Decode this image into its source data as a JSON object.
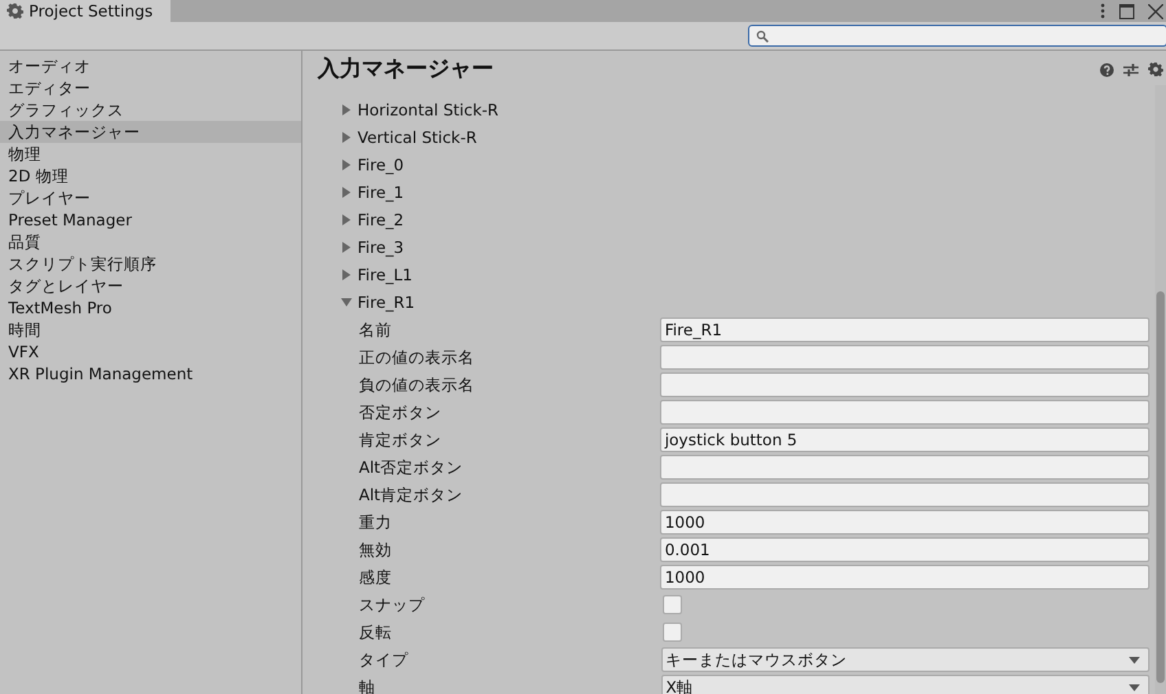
{
  "window": {
    "title": "Project Settings"
  },
  "sidebar": {
    "items": [
      {
        "label": "オーディオ",
        "selected": false
      },
      {
        "label": "エディター",
        "selected": false
      },
      {
        "label": "グラフィックス",
        "selected": false
      },
      {
        "label": "入力マネージャー",
        "selected": true
      },
      {
        "label": "物理",
        "selected": false
      },
      {
        "label": "2D 物理",
        "selected": false
      },
      {
        "label": "プレイヤー",
        "selected": false
      },
      {
        "label": "Preset Manager",
        "selected": false
      },
      {
        "label": "品質",
        "selected": false
      },
      {
        "label": "スクリプト実行順序",
        "selected": false
      },
      {
        "label": "タグとレイヤー",
        "selected": false
      },
      {
        "label": "TextMesh Pro",
        "selected": false
      },
      {
        "label": "時間",
        "selected": false
      },
      {
        "label": "VFX",
        "selected": false
      },
      {
        "label": "XR Plugin Management",
        "selected": false
      }
    ]
  },
  "inspector": {
    "title": "入力マネージャー",
    "axes": [
      {
        "label": "Horizontal Stick-R",
        "expanded": false
      },
      {
        "label": "Vertical Stick-R",
        "expanded": false
      },
      {
        "label": "Fire_0",
        "expanded": false
      },
      {
        "label": "Fire_1",
        "expanded": false
      },
      {
        "label": "Fire_2",
        "expanded": false
      },
      {
        "label": "Fire_3",
        "expanded": false
      },
      {
        "label": "Fire_L1",
        "expanded": false
      },
      {
        "label": "Fire_R1",
        "expanded": true,
        "properties": [
          {
            "kind": "text",
            "label": "名前",
            "value": "Fire_R1"
          },
          {
            "kind": "text",
            "label": "正の値の表示名"
          },
          {
            "kind": "text",
            "label": "負の値の表示名"
          },
          {
            "kind": "text",
            "label": "否定ボタン"
          },
          {
            "kind": "text",
            "label": "肯定ボタン",
            "value": "joystick button 5"
          },
          {
            "kind": "text",
            "label": "Alt否定ボタン"
          },
          {
            "kind": "text",
            "label": "Alt肯定ボタン"
          },
          {
            "kind": "text",
            "label": "重力",
            "value": "1000"
          },
          {
            "kind": "text",
            "label": "無効",
            "value": "0.001"
          },
          {
            "kind": "text",
            "label": "感度",
            "value": "1000"
          },
          {
            "kind": "checkbox",
            "label": "スナップ",
            "checked": false
          },
          {
            "kind": "checkbox",
            "label": "反転",
            "checked": false
          },
          {
            "kind": "dropdown",
            "label": "タイプ",
            "value": "キーまたはマウスボタン"
          },
          {
            "kind": "dropdown",
            "label": "軸",
            "value": "X軸"
          }
        ]
      }
    ]
  }
}
